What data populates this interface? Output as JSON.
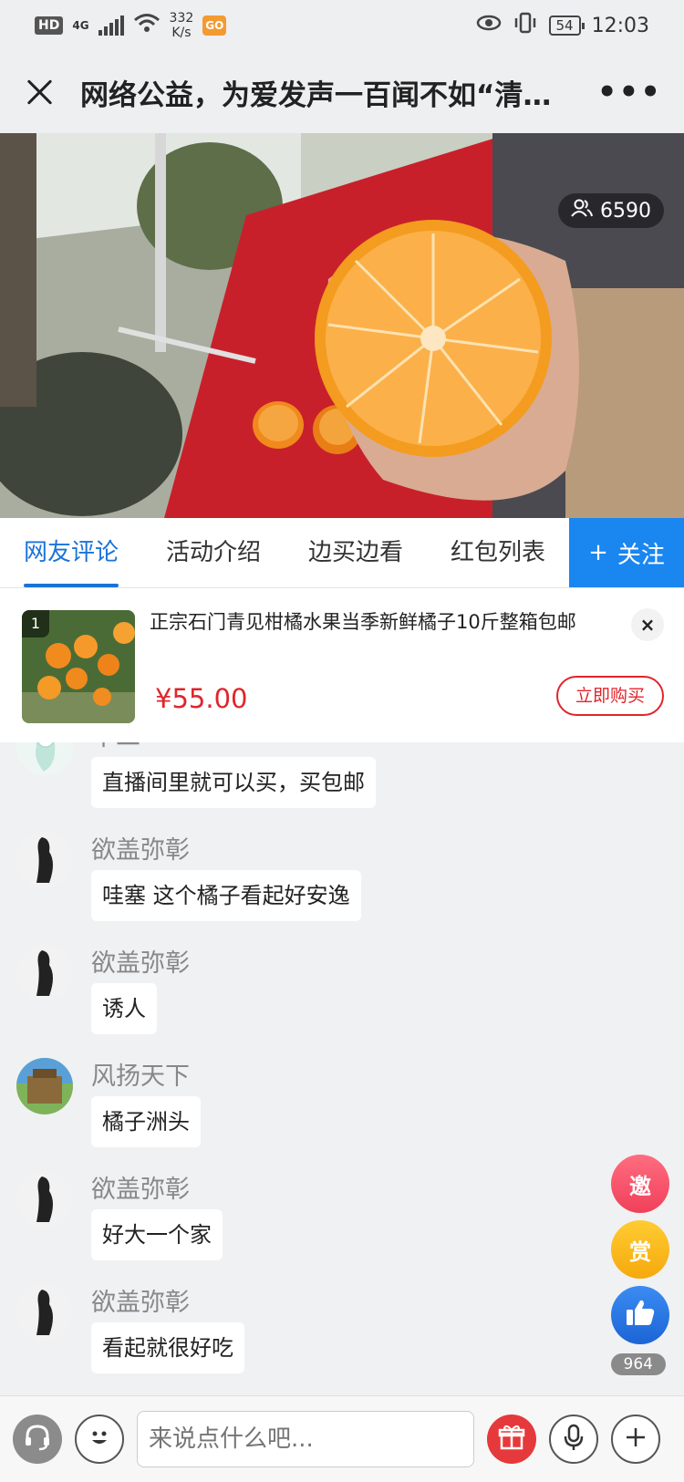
{
  "status_bar": {
    "hd": "HD",
    "network": "4G",
    "speed_value": "332",
    "speed_unit": "K/s",
    "go_badge": "GO",
    "battery": "54",
    "time": "12:03"
  },
  "header": {
    "title": "网络公益，为爱发声一百闻不如“清…"
  },
  "video": {
    "viewer_count": "6590"
  },
  "tabs": [
    {
      "label": "网友评论",
      "active": true
    },
    {
      "label": "活动介绍",
      "active": false
    },
    {
      "label": "边买边看",
      "active": false
    },
    {
      "label": "红包列表",
      "active": false
    }
  ],
  "follow_button": {
    "label": "关注",
    "icon": "plus-icon"
  },
  "product": {
    "index": "1",
    "name": "正宗石门青见柑橘水果当季新鲜橘子10斤整箱包邮",
    "price": "¥55.00",
    "buy_label": "立即购买",
    "close_label": "×"
  },
  "comments": [
    {
      "user": "十二",
      "text": "直播间里就可以买，买包邮"
    },
    {
      "user": "欲盖弥彰",
      "text": "哇塞  这个橘子看起好安逸"
    },
    {
      "user": "欲盖弥彰",
      "text": "诱人"
    },
    {
      "user": "风扬天下",
      "text": "橘子洲头"
    },
    {
      "user": "欲盖弥彰",
      "text": "好大一个家"
    },
    {
      "user": "欲盖弥彰",
      "text": "看起就很好吃"
    }
  ],
  "side_actions": {
    "invite_label": "邀",
    "reward_label": "赏",
    "like_count": "964"
  },
  "input": {
    "placeholder": "来说点什么吧..."
  },
  "colors": {
    "accent_blue": "#1a86f0",
    "price_red": "#e0252b"
  }
}
